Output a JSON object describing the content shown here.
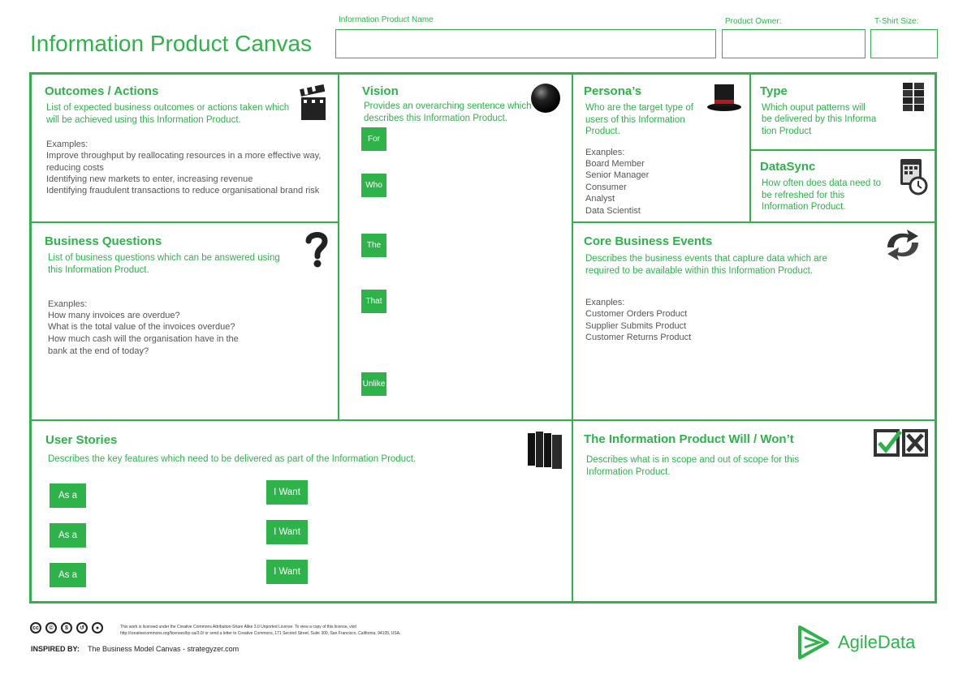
{
  "page_title": "Information Product Canvas",
  "header": {
    "product_name_label": "Information Product Name",
    "owner_label": "Product Owner:",
    "tshirt_label": "T-Shirt Size:"
  },
  "outcomes": {
    "title": "Outcomes / Actions",
    "desc": "List of expected business outcomes or actions taken which will be achieved using this Information Product.",
    "examples_label": "Examples:",
    "examples": [
      "Improve throughput by reallocating resources in a more effective way, reducing costs",
      "Identifying new markets to enter, increasing revenue",
      "Identifying fraudulent transactions to reduce organisational brand risk"
    ]
  },
  "vision": {
    "title": "Vision",
    "desc": "Provides an overarching sentence which describes this Information Product.",
    "tags": [
      "For",
      "Who",
      "The",
      "That",
      "Unlike"
    ]
  },
  "personas": {
    "title": "Persona’s",
    "desc": "Who are the target type of users of this Information Product.",
    "examples_label": "Exanples:",
    "examples": [
      "Board Member",
      "Senior Manager",
      "Consumer",
      "Analyst",
      "Data Scientist"
    ]
  },
  "type": {
    "title": "Type",
    "desc_lines": [
      "Which ouput patterns will",
      "be delivered by this Informa",
      "tion Product"
    ]
  },
  "datasync": {
    "title": "DataSync",
    "desc": "How often does data need to be refreshed for this Information Product."
  },
  "business_questions": {
    "title": "Business Questions",
    "desc": "List of business questions which can be answered using this Information Product.",
    "examples_label": "Exanples:",
    "examples": [
      "How many invoices are overdue?",
      "What is the total value of the invoices overdue?",
      "How much cash will the organisation have in the bank at the end of today?"
    ]
  },
  "core_events": {
    "title": "Core Business Events",
    "desc": "Describes the business events that capture data which are required to be available within this Information Product.",
    "examples_label": "Exanples:",
    "examples": [
      "Customer Orders Product",
      "Supplier Submits Product",
      "Customer Returns Product"
    ]
  },
  "user_stories": {
    "title": "User Stories",
    "desc": "Describes the key features which need to be delivered as part of the Information Product.",
    "as_a": [
      "As a",
      "As a",
      "As a"
    ],
    "i_want": [
      "I Want",
      "I Want",
      "I Want"
    ]
  },
  "will_wont": {
    "title": "The Information Product Will / Won’t",
    "desc": "Describes what is in scope and out of scope for this Information Product."
  },
  "footer": {
    "license_line1": "This work is licensed under the Creative Commons Attribution-Share Alike 3.0 Unported License. To view a copy of this license, visit",
    "license_line2": "http://creativecommons.org/licenses/by-sa/3.0/ or send a letter to Creative Commons, 171 Second Street, Suite 300, San Francisco, California, 94105, USA.",
    "inspired_label": "INSPIRED BY:",
    "inspired_text": "The Business Model Canvas - strategyzer.com",
    "brand": "AgileData"
  },
  "colors": {
    "accent": "#2db34a",
    "text": "#555555"
  }
}
